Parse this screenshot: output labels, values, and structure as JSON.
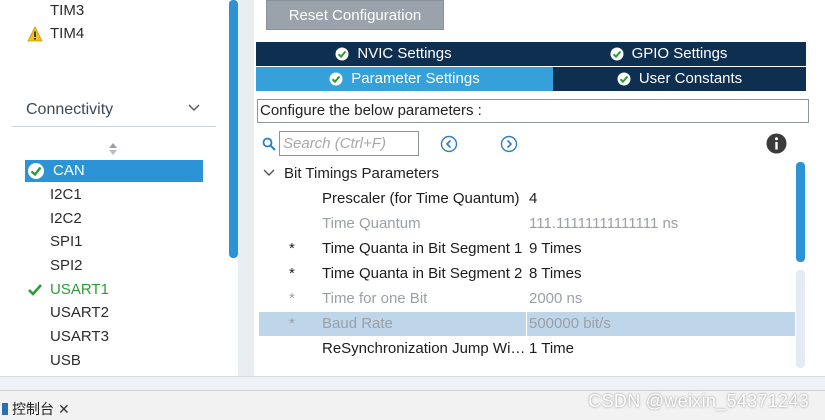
{
  "left": {
    "items_top": [
      {
        "label": "TIM3",
        "warn": false
      },
      {
        "label": "TIM4",
        "warn": true
      }
    ],
    "section_title": "Connectivity",
    "items": [
      {
        "label": "CAN"
      },
      {
        "label": "I2C1"
      },
      {
        "label": "I2C2"
      },
      {
        "label": "SPI1"
      },
      {
        "label": "SPI2"
      },
      {
        "label": "USART1"
      },
      {
        "label": "USART2"
      },
      {
        "label": "USART3"
      },
      {
        "label": "USB"
      }
    ],
    "selected_color": "#2b93d6",
    "ok_color": "#2e9a3a"
  },
  "toolbar": {
    "reset_label": "Reset Configuration"
  },
  "tabs": {
    "nvic": "NVIC Settings",
    "gpio": "GPIO Settings",
    "param": "Parameter Settings",
    "user": "User Constants"
  },
  "config_label": "Configure the below parameters :",
  "search": {
    "placeholder": "Search (Ctrl+F)"
  },
  "group": {
    "title": "Bit Timings Parameters"
  },
  "params": [
    {
      "star": "",
      "name": "Prescaler (for Time Quantum)",
      "value": "4"
    },
    {
      "star": "",
      "name": "Time Quantum",
      "value": "111.11111111111111 ns"
    },
    {
      "star": "*",
      "name": "Time Quanta in Bit Segment 1",
      "value": "9 Times"
    },
    {
      "star": "*",
      "name": "Time Quanta in Bit Segment 2",
      "value": "8 Times"
    },
    {
      "star": "*",
      "name": "Time for one Bit",
      "value": "2000 ns"
    },
    {
      "star": "*",
      "name": "Baud Rate",
      "value": "500000 bit/s"
    },
    {
      "star": "",
      "name": "ReSynchronization Jump Width",
      "value": "1 Time"
    }
  ],
  "bottom": {
    "console_label": "控制台",
    "close_glyph": "✕",
    "watermark": "CSDN @weixin_54371243"
  }
}
